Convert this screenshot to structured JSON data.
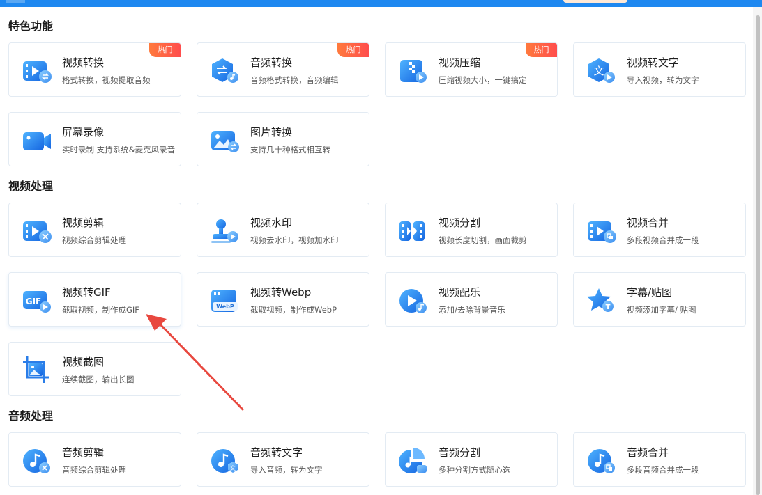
{
  "sections": [
    {
      "title": "特色功能",
      "items": [
        {
          "title": "视频转换",
          "desc": "格式转换，视频提取音频",
          "badge": "热门",
          "icon": "video-convert-icon"
        },
        {
          "title": "音频转换",
          "desc": "音频格式转换，音频编辑",
          "badge": "热门",
          "icon": "audio-convert-icon"
        },
        {
          "title": "视频压缩",
          "desc": "压缩视频大小，一键搞定",
          "badge": "热门",
          "icon": "video-compress-icon"
        },
        {
          "title": "视频转文字",
          "desc": "导入视频，转为文字",
          "icon": "video-to-text-icon"
        },
        {
          "title": "屏幕录像",
          "desc": "实时录制 支持系统&麦克风录音",
          "icon": "screen-record-icon"
        },
        {
          "title": "图片转换",
          "desc": "支持几十种格式相互转",
          "icon": "image-convert-icon"
        }
      ]
    },
    {
      "title": "视频处理",
      "items": [
        {
          "title": "视频剪辑",
          "desc": "视频综合剪辑处理",
          "icon": "video-edit-icon"
        },
        {
          "title": "视频水印",
          "desc": "视频去水印，视频加水印",
          "icon": "video-watermark-icon"
        },
        {
          "title": "视频分割",
          "desc": "视频长度切割，画面裁剪",
          "icon": "video-split-icon"
        },
        {
          "title": "视频合并",
          "desc": "多段视频合并成一段",
          "icon": "video-merge-icon"
        },
        {
          "title": "视频转GIF",
          "desc": "截取视频，制作成GIF",
          "icon": "video-to-gif-icon",
          "icon_text": "GIF"
        },
        {
          "title": "视频转Webp",
          "desc": "截取视频，制作成WebP",
          "icon": "video-to-webp-icon",
          "icon_text": "WebP"
        },
        {
          "title": "视频配乐",
          "desc": "添加/去除背景音乐",
          "icon": "video-music-icon"
        },
        {
          "title": "字幕/贴图",
          "desc": "视频添加字幕/ 贴图",
          "icon": "subtitle-sticker-icon",
          "icon_text": "T"
        },
        {
          "title": "视频截图",
          "desc": "连续截图，输出长图",
          "icon": "video-screenshot-icon"
        }
      ]
    },
    {
      "title": "音频处理",
      "items": [
        {
          "title": "音频剪辑",
          "desc": "音频综合剪辑处理",
          "icon": "audio-edit-icon"
        },
        {
          "title": "音频转文字",
          "desc": "导入音频，转为文字",
          "icon": "audio-to-text-icon",
          "icon_text": "文"
        },
        {
          "title": "音频分割",
          "desc": "多种分割方式随心选",
          "icon": "audio-split-icon"
        },
        {
          "title": "音频合并",
          "desc": "多段音频合并成一段",
          "icon": "audio-merge-icon"
        }
      ]
    }
  ],
  "video_to_text_glyph": "文",
  "colors": {
    "accent": "#1e88f0",
    "badge": "#ff5a3c",
    "arrow": "#e8483f"
  },
  "annotation": {
    "type": "arrow",
    "target": "视频转GIF"
  }
}
